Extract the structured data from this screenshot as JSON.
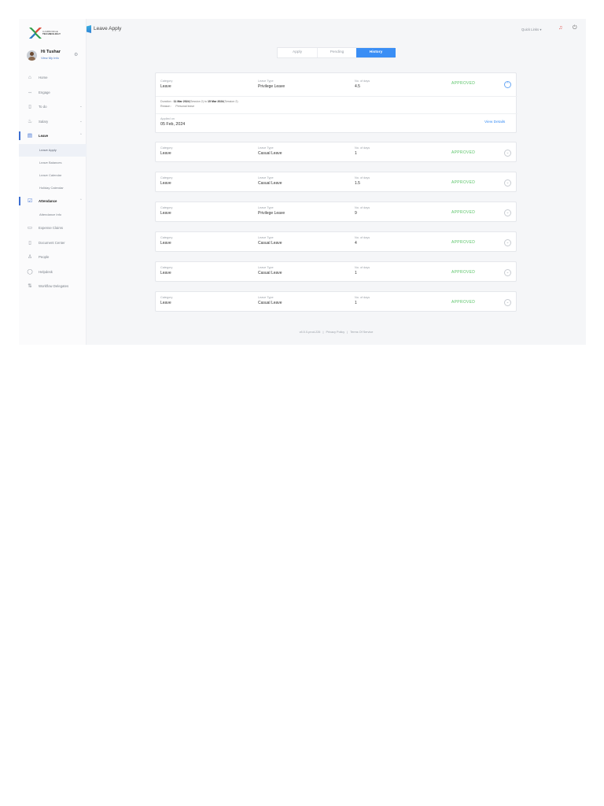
{
  "brand": {
    "logo_text_1": "CAMBRIDGE",
    "logo_text_2": "TECHNOLOGY"
  },
  "user": {
    "greeting": "Hi Tushar",
    "link": "View My Info"
  },
  "topbar": {
    "page_title": "Leave Apply",
    "quick_links": "Quick Links ▾"
  },
  "sidebar": {
    "items": [
      {
        "label": "Home",
        "icon": "home-icon"
      },
      {
        "label": "Engage",
        "icon": "engage-icon"
      },
      {
        "label": "To do",
        "icon": "clipboard-icon"
      },
      {
        "label": "Salary",
        "icon": "salary-icon"
      },
      {
        "label": "Leave",
        "icon": "calendar-icon"
      },
      {
        "label": "Attendance",
        "icon": "attendance-icon"
      },
      {
        "label": "Expense Claims",
        "icon": "wallet-icon"
      },
      {
        "label": "Document Center",
        "icon": "document-icon"
      },
      {
        "label": "People",
        "icon": "people-icon"
      },
      {
        "label": "Helpdesk",
        "icon": "help-icon"
      },
      {
        "label": "Workflow Delegates",
        "icon": "workflow-icon"
      }
    ],
    "leave_sub": [
      "Leave Apply",
      "Leave Balances",
      "Leave Calendar",
      "Holiday Calendar"
    ],
    "attendance_sub": [
      "Attendance Info"
    ]
  },
  "tabs": [
    "Apply",
    "Pending",
    "History"
  ],
  "field_labels": {
    "category": "Category",
    "leave_type": "Leave Type",
    "days": "No. of days"
  },
  "expanded": {
    "duration_label": "Duration :",
    "duration_from": "11 Mar 2024",
    "from_session": "(Session 2)",
    "to_word": "to",
    "duration_to": "15 Mar 2024",
    "to_session": "(Session 2)",
    "reason_label": "Reason :",
    "reason": "Personal leave",
    "applied_label": "Applied on",
    "applied_date": "05 Feb, 2024",
    "view_details": "View Details"
  },
  "records": [
    {
      "category": "Leave",
      "leave_type": "Privilege Leave",
      "days": "4.5",
      "status": "APPROVED"
    },
    {
      "category": "Leave",
      "leave_type": "Casual Leave",
      "days": "1",
      "status": "APPROVED"
    },
    {
      "category": "Leave",
      "leave_type": "Casual Leave",
      "days": "1.5",
      "status": "APPROVED"
    },
    {
      "category": "Leave",
      "leave_type": "Privilege Leave",
      "days": "9",
      "status": "APPROVED"
    },
    {
      "category": "Leave",
      "leave_type": "Casual Leave",
      "days": "4",
      "status": "APPROVED"
    },
    {
      "category": "Leave",
      "leave_type": "Casual Leave",
      "days": "1",
      "status": "APPROVED"
    },
    {
      "category": "Leave",
      "leave_type": "Casual Leave",
      "days": "1",
      "status": "APPROVED"
    }
  ],
  "footer": {
    "version": "v6.5.0-prod-226",
    "sep": "|",
    "privacy": "Privacy Policy",
    "terms": "Terms Of Service"
  },
  "colors": {
    "accent": "#3a8ef5",
    "approved": "#5cc46a",
    "nav_active": "#3d6fd1"
  }
}
